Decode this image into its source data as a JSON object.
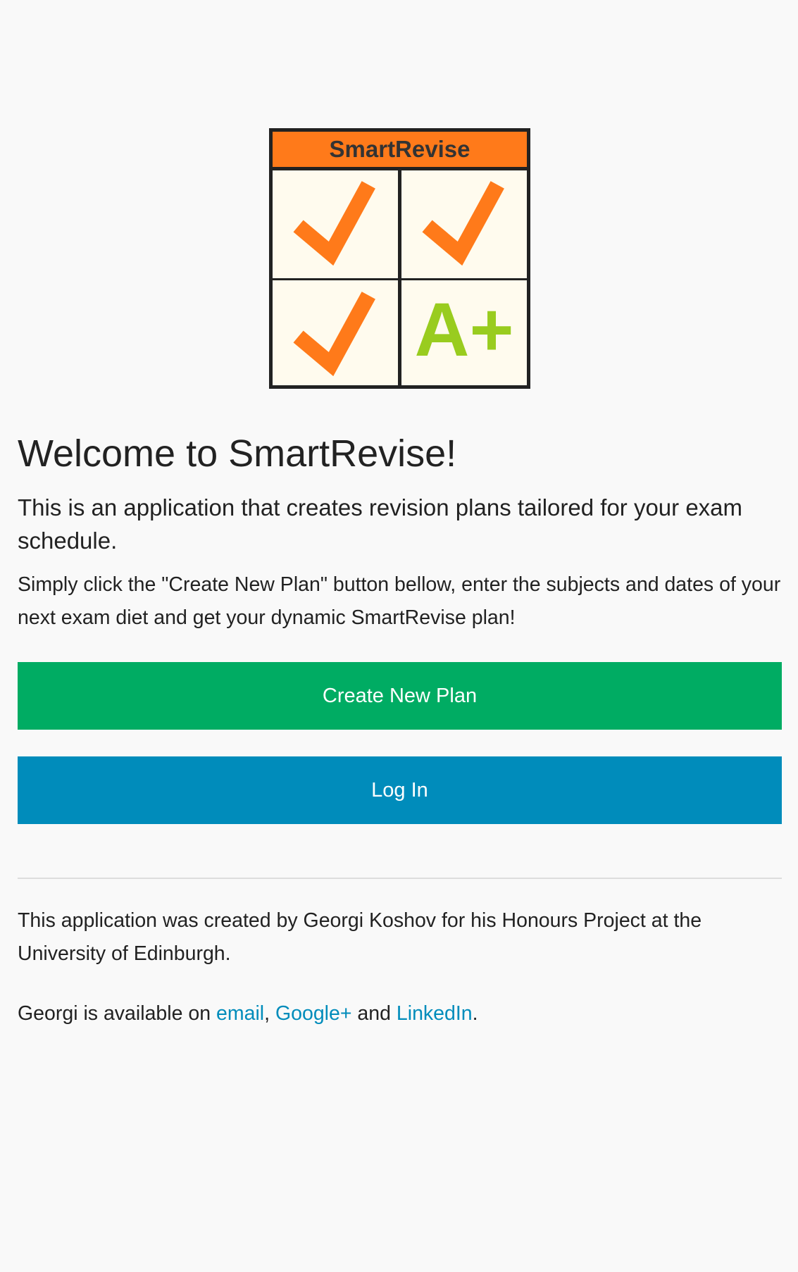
{
  "colors": {
    "background": "#f9f9f9",
    "create_button": "#00ac63",
    "login_button": "#008cbb",
    "link": "#008cbb",
    "logo_orange": "#ff7a1a",
    "logo_green": "#99cc1f",
    "logo_cell": "#fffbee"
  },
  "logo": {
    "banner_text": "SmartRevise",
    "grade_text": "A+"
  },
  "welcome": {
    "title": "Welcome to SmartRevise!",
    "lead": "This is an application that creates revision plans tailored for your exam schedule.",
    "instructions": "Simply click the \"Create New Plan\" button bellow, enter the subjects and dates of your next exam diet and get your dynamic SmartRevise plan!"
  },
  "actions": {
    "create_label": "Create New Plan",
    "login_label": "Log In"
  },
  "footer": {
    "credit": "This application was created by Georgi Koshov for his Honours Project at the University of Edinburgh.",
    "contact_prefix": "Georgi is available on ",
    "email_label": "email",
    "comma": ",",
    "googleplus_label": "Google+",
    "and_text": " and ",
    "linkedin_label": "LinkedIn",
    "period": "."
  }
}
